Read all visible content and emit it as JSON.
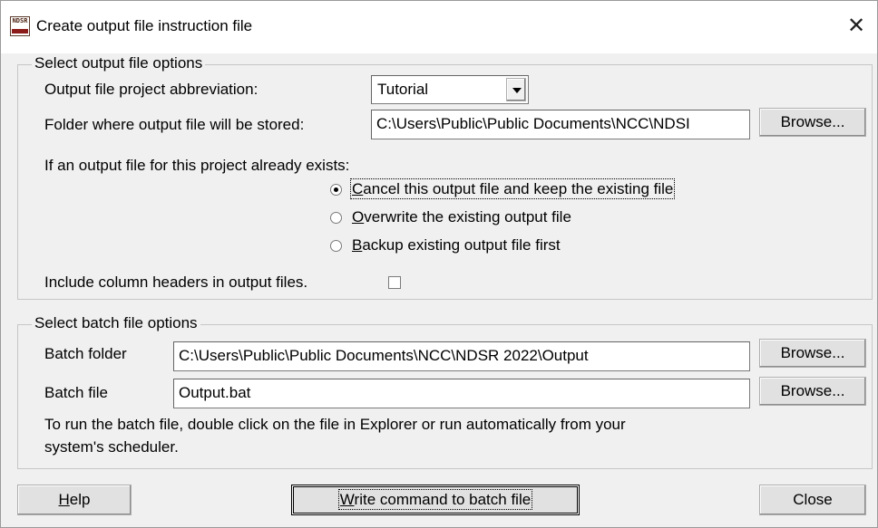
{
  "window": {
    "title": "Create output file instruction file",
    "icon": "ndsr-app-icon",
    "icon_text": "NDSR"
  },
  "output_options": {
    "group_label": "Select output file options",
    "abbrev_label": "Output file project abbreviation:",
    "abbrev_value": "Tutorial",
    "folder_label": "Folder where output file will be stored:",
    "folder_value": "C:\\Users\\Public\\Public Documents\\NCC\\NDSI",
    "browse_label": "Browse...",
    "exists_label": "If an output file for this project already exists:",
    "radio_options": [
      {
        "label": "Cancel this output file and keep the existing file",
        "mnemonic": "C",
        "rest": "ancel this output file and keep the existing file",
        "selected": true
      },
      {
        "label": "Overwrite the existing output file",
        "mnemonic": "O",
        "rest": "verwrite the existing output file",
        "selected": false
      },
      {
        "label": "Backup existing output file first",
        "mnemonic": "B",
        "rest": "ackup existing output file first",
        "selected": false
      }
    ],
    "headers_label": "Include column headers in output files.",
    "headers_checked": false
  },
  "batch_options": {
    "group_label": "Select batch file options",
    "folder_label": "Batch folder",
    "folder_value": "C:\\Users\\Public\\Public Documents\\NCC\\NDSR 2022\\Output",
    "file_label": "Batch file",
    "file_value": "Output.bat",
    "browse_label": "Browse...",
    "note_line1": "To run the batch file, double click on the file in Explorer or run automatically from your",
    "note_line2": "system's scheduler."
  },
  "footer": {
    "help_mn": "H",
    "help_rest": "elp",
    "write_mn": "W",
    "write_rest": "rite command to batch file",
    "close_label": "Close"
  }
}
